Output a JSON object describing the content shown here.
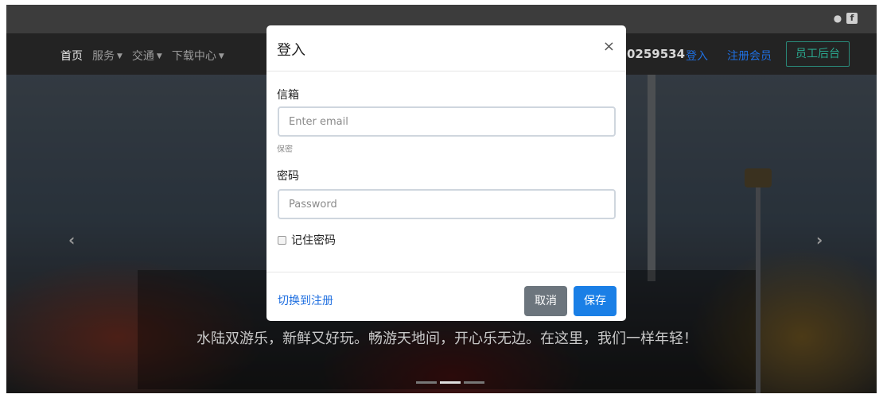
{
  "social": {
    "icons": [
      "weibo-icon",
      "facebook-icon"
    ],
    "fb_glyph": "f"
  },
  "nav": {
    "items": [
      {
        "label": "首页",
        "caret": ""
      },
      {
        "label": "服务",
        "caret": "▼"
      },
      {
        "label": "交通",
        "caret": "▼"
      },
      {
        "label": "下载中心",
        "caret": "▼"
      }
    ],
    "phone": "0259534",
    "login": "登入",
    "register": "注册会员",
    "staff": "员工后台"
  },
  "carousel": {
    "prev": "‹",
    "next": "›",
    "caption": "水陆双游乐，新鲜又好玩。畅游天地间，开心乐无边。在这里，我们一样年轻！",
    "active_index": 1
  },
  "modal": {
    "title": "登入",
    "close": "×",
    "email_label": "信箱",
    "email_placeholder": "Enter email",
    "email_hint": "保密",
    "password_label": "密码",
    "password_placeholder": "Password",
    "remember_label": "记住密码",
    "switch_link": "切换到注册",
    "cancel": "取消",
    "save": "保存"
  }
}
